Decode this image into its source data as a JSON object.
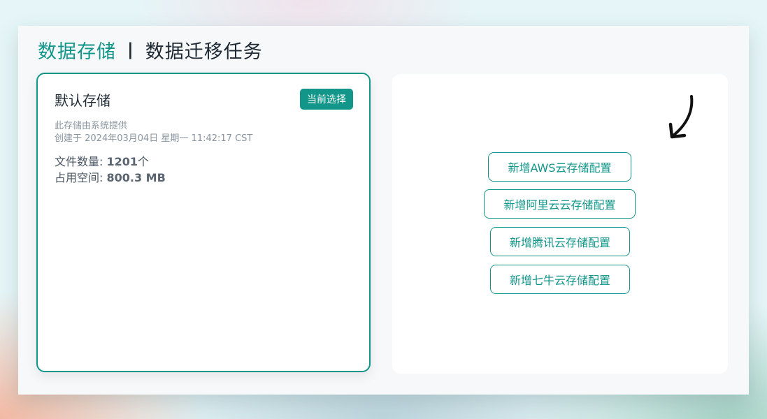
{
  "header": {
    "active_title": "数据存储",
    "separator": "|",
    "other_title": "数据迁移任务"
  },
  "default_storage": {
    "title": "默认存储",
    "badge": "当前选择",
    "provider_note": "此存储由系统提供",
    "created_at": "创建于 2024年03月04日 星期一 11:42:17 CST",
    "file_count_label": "文件数量: ",
    "file_count_value": "1201",
    "file_count_unit": "个",
    "space_label": "占用空间: ",
    "space_value": "800.3 MB"
  },
  "add_storage": {
    "buttons": [
      {
        "label": "新增AWS云存储配置"
      },
      {
        "label": "新增阿里云云存储配置"
      },
      {
        "label": "新增腾讯云存储配置"
      },
      {
        "label": "新增七牛云存储配置"
      }
    ]
  },
  "colors": {
    "accent": "#12968a",
    "text_primary": "#1f2933",
    "text_muted": "#8a949e"
  }
}
